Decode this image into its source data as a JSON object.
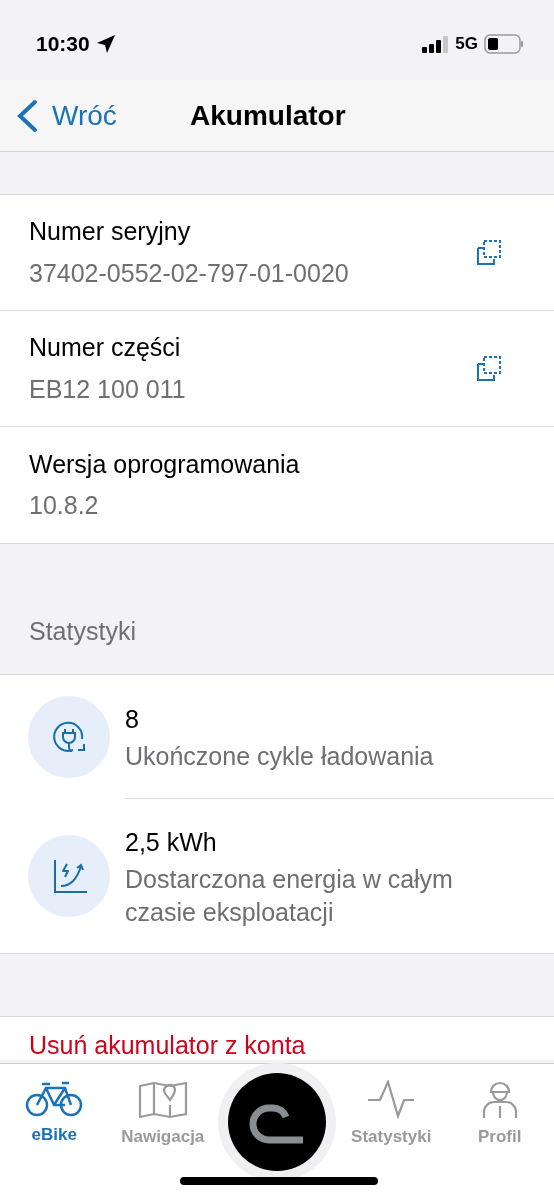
{
  "status_bar": {
    "time": "10:30",
    "network": "5G"
  },
  "nav": {
    "back": "Wróć",
    "title": "Akumulator"
  },
  "info_rows": [
    {
      "label": "Numer seryjny",
      "value": "37402-0552-02-797-01-0020",
      "copyable": true
    },
    {
      "label": "Numer części",
      "value": "EB12 100 011",
      "copyable": true
    },
    {
      "label": "Wersja oprogramowania",
      "value": "10.8.2",
      "copyable": false
    }
  ],
  "stats": {
    "header": "Statystyki",
    "items": [
      {
        "kind": "charge",
        "value": "8",
        "label": "Ukończone cykle ładowania"
      },
      {
        "kind": "energy",
        "value": "2,5 kWh",
        "label": "Dostarczona energia w całym czasie eksploatacji"
      }
    ]
  },
  "remove_action": "Usuń akumulator z konta",
  "tabs": [
    {
      "kind": "bike",
      "label": "eBike",
      "selected": true
    },
    {
      "kind": "map",
      "label": "Nawigacja",
      "selected": false
    },
    {
      "kind": "center"
    },
    {
      "kind": "stats",
      "label": "Statystyki",
      "selected": false
    },
    {
      "kind": "profile",
      "label": "Profil",
      "selected": false
    }
  ]
}
